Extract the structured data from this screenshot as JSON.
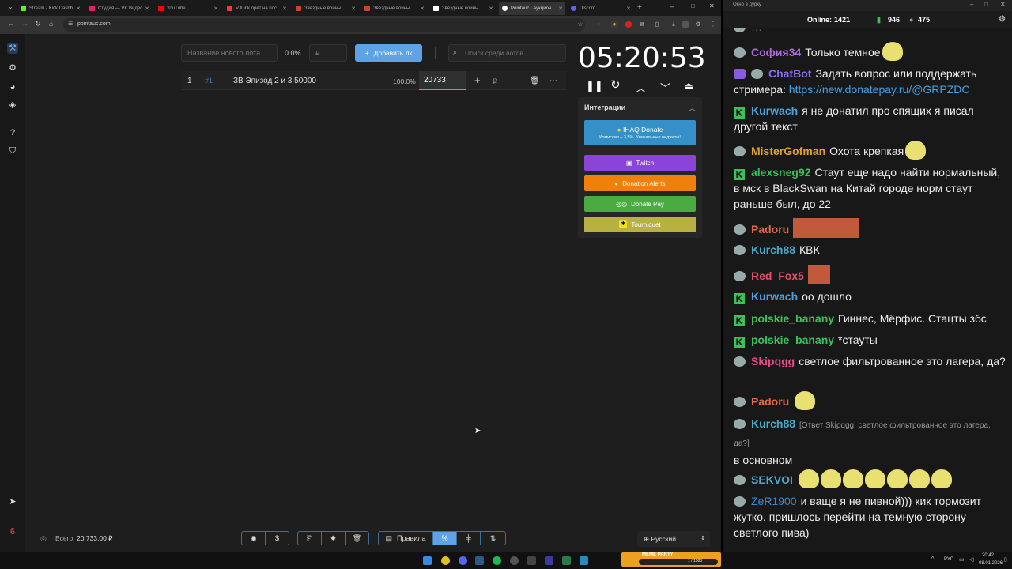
{
  "browser": {
    "tabs": [
      {
        "label": "Stream - Kick Dashboard",
        "color": "#53fc18"
      },
      {
        "label": "Студия — VK Видео",
        "color": "#e0245e"
      },
      {
        "label": "YouTube",
        "color": "#ff0000"
      },
      {
        "label": "VJLink орёт на пос...",
        "color": "#ff3344"
      },
      {
        "label": "Звёздные войны...",
        "color": "#d0402a"
      },
      {
        "label": "Звёздные войны...",
        "color": "#d0402a"
      },
      {
        "label": "Звёздные войны...",
        "color": "#ffffff"
      },
      {
        "label": "Pointauc | Аукцион...",
        "color": "#ffffff"
      },
      {
        "label": "Discord",
        "color": "#5865f2"
      }
    ],
    "url": "pointauc.com"
  },
  "lot_form": {
    "name_placeholder": "Название нового лота",
    "percent": "0.0%",
    "amount_placeholder": "₽",
    "add_label": "Добавить лк",
    "search_placeholder": "Поиск среди лотов..."
  },
  "lots": [
    {
      "index": "1",
      "tag": "#1",
      "name": "ЗВ Эпизод 2 и 3 50000",
      "percent": "100.0%",
      "value": "20733",
      "currency": "₽"
    }
  ],
  "timer": {
    "time": "05:20:53"
  },
  "integrations": {
    "title": "Интеграции",
    "ihaq": {
      "label": "IHAQ Donate",
      "sub": "Комиссия – 3,5%. Уникальные виджеты!"
    },
    "twitch": "Twitch",
    "donation_alerts": "Donation Alerts",
    "donate_pay": "Donate Pay",
    "tourniquet": "Tourniquet"
  },
  "footer": {
    "total_label": "Всего:",
    "total_value": "20.733,00 ₽",
    "rules_label": "Правила",
    "language": "Русский"
  },
  "chat": {
    "window_title": "Окно в дурку",
    "online_label": "Online:",
    "online_count": "1421",
    "kick_count": "946",
    "other_count": "475",
    "messages": [
      {
        "user": "София34",
        "text": "Только темное",
        "color": "#b06ae0"
      },
      {
        "user": "ChatBot",
        "text": "Задать вопрос или поддержать стримера:",
        "link": "https://new.donatepay.ru/@GRPZDC",
        "color": "#8a6be8"
      },
      {
        "user": "Kurwach",
        "text": "я не донатил про спящих я писал другой текст",
        "color": "#4aa0e0"
      },
      {
        "user": "MisterGofman",
        "text": "Охота крепкая",
        "color": "#e0a030"
      },
      {
        "user": "alexsneg92",
        "text": "Стаут еще надо найти нормальный, в мск в BlackSwan на Китай городе норм стаут раньше был, до 22",
        "color": "#3cc05c"
      },
      {
        "user": "Padoru",
        "text": "",
        "color": "#e06a4a"
      },
      {
        "user": "Kurch88",
        "text": "КВК",
        "color": "#4aa8c8"
      },
      {
        "user": "Red_Fox5",
        "text": "",
        "color": "#e0506a"
      },
      {
        "user": "Kurwach",
        "text": "оо дошло",
        "color": "#4aa0e0"
      },
      {
        "user": "polskie_banany",
        "text": "Гиннес, Мёрфис. Стацты збс",
        "color": "#3cc05c"
      },
      {
        "user": "polskie_banany",
        "text": "*стауты",
        "color": "#3cc05c"
      },
      {
        "user": "Skipqgg",
        "text": "светлое фильтрованное это лагера, да?",
        "color": "#e0508a"
      },
      {
        "user": "Padoru",
        "text": "",
        "color": "#e06a4a"
      },
      {
        "user": "Kurch88",
        "reply": "[Ответ Skipqgg: светлое фильтрованное это лагера, да?]",
        "text": "в основном",
        "color": "#4aa8c8"
      },
      {
        "user": "SEKVOI",
        "text": "",
        "color": "#4aa8c8"
      },
      {
        "user": "ZeR1900",
        "text": "и ваще я не пивной))) кик тормозит жутко. пришлось перейти на темную сторону светлого пива)",
        "color": "#3a8ad0"
      }
    ]
  },
  "taskbar": {
    "lang": "РУС",
    "time": "20:42",
    "date": "08.01.2026",
    "widget_label": "MEME PARTY",
    "widget_count": "1 / 1500"
  }
}
